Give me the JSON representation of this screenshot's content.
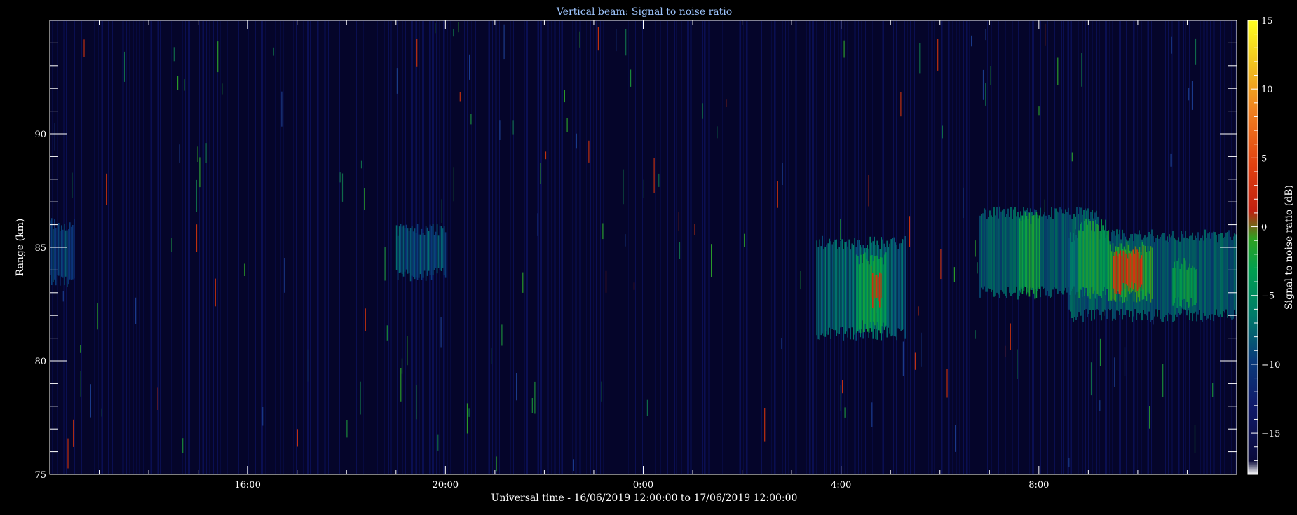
{
  "chart_data": {
    "type": "heatmap",
    "title": "Vertical beam: Signal to noise ratio",
    "xlabel": "Universal time - 16/06/2019 12:00:00 to 17/06/2019 12:00:00",
    "ylabel": "Range (km)",
    "colorbar_label": "Signal to noise ratio (dB)",
    "x_range_hours": [
      12,
      36
    ],
    "y_range_km": [
      75,
      95
    ],
    "color_range_db": [
      -18,
      15
    ],
    "x_ticks": [
      {
        "hour": 16,
        "label": "16:00"
      },
      {
        "hour": 20,
        "label": "20:00"
      },
      {
        "hour": 24,
        "label": "0:00"
      },
      {
        "hour": 28,
        "label": "4:00"
      },
      {
        "hour": 32,
        "label": "8:00"
      }
    ],
    "y_ticks": [
      {
        "value": 75,
        "label": "75"
      },
      {
        "value": 80,
        "label": "80"
      },
      {
        "value": 85,
        "label": "85"
      },
      {
        "value": 90,
        "label": "90"
      }
    ],
    "colorbar_ticks": [
      {
        "value": -15,
        "label": "−15"
      },
      {
        "value": -10,
        "label": "−10"
      },
      {
        "value": -5,
        "label": "−5"
      },
      {
        "value": 0,
        "label": "0"
      },
      {
        "value": 5,
        "label": "5"
      },
      {
        "value": 10,
        "label": "10"
      },
      {
        "value": 15,
        "label": "15"
      }
    ],
    "background_db": -16,
    "echo_regions": [
      {
        "t_start": 12.0,
        "t_end": 12.5,
        "r_min": 83.5,
        "r_max": 86.0,
        "snr_db": -12
      },
      {
        "t_start": 19.0,
        "t_end": 20.0,
        "r_min": 83.8,
        "r_max": 85.8,
        "snr_db": -11
      },
      {
        "t_start": 27.5,
        "t_end": 29.3,
        "r_min": 81.2,
        "r_max": 85.2,
        "snr_db": -10
      },
      {
        "t_start": 28.3,
        "t_end": 28.9,
        "r_min": 81.5,
        "r_max": 84.5,
        "snr_db": -6
      },
      {
        "t_start": 28.6,
        "t_end": 28.8,
        "r_min": 82.5,
        "r_max": 84.0,
        "snr_db": -1
      },
      {
        "t_start": 30.8,
        "t_end": 33.2,
        "r_min": 83.0,
        "r_max": 86.5,
        "snr_db": -10
      },
      {
        "t_start": 31.6,
        "t_end": 32.0,
        "r_min": 83.0,
        "r_max": 86.3,
        "snr_db": -5
      },
      {
        "t_start": 32.6,
        "t_end": 36.0,
        "r_min": 82.0,
        "r_max": 85.5,
        "snr_db": -10
      },
      {
        "t_start": 32.8,
        "t_end": 33.4,
        "r_min": 83.0,
        "r_max": 86.0,
        "snr_db": -5
      },
      {
        "t_start": 33.4,
        "t_end": 34.3,
        "r_min": 82.8,
        "r_max": 85.0,
        "snr_db": -4
      },
      {
        "t_start": 33.5,
        "t_end": 34.1,
        "r_min": 83.2,
        "r_max": 84.8,
        "snr_db": 0
      },
      {
        "t_start": 34.7,
        "t_end": 35.2,
        "r_min": 82.5,
        "r_max": 84.3,
        "snr_db": -6
      }
    ]
  }
}
